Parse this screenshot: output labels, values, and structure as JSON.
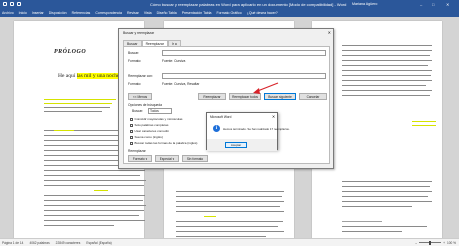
{
  "titlebar": {
    "document_title": "Cómo buscar y reemplazar palabras en Word para aplicarlo en un documento [Modo de compatibilidad] - Word",
    "user": "Mariana Agüero",
    "min": "–",
    "max": "□",
    "close": "✕"
  },
  "ribbon": {
    "tabs": [
      "Archivo",
      "Inicio",
      "Insertar",
      "Disposición",
      "Referencias",
      "Correspondencia",
      "Revisar",
      "Vista",
      "Diseño Tabla",
      "Presentación Tabla",
      "Formato Gráfico"
    ],
    "active_tab": "Inicio",
    "tell_me": "¿Qué desea hacer?"
  },
  "document": {
    "heading": "PRÓLOGO",
    "subhead_prefix": "He aquí ",
    "subhead_highlight": "las mil y una noches",
    "subhead_suffix": "..."
  },
  "find_replace": {
    "title": "Buscar y reemplazar",
    "close": "✕",
    "tabs": [
      "Buscar",
      "Reemplazar",
      "Ir a"
    ],
    "active_tab": "Reemplazar",
    "find_label": "Buscar:",
    "find_format_label": "Formato:",
    "find_format_value": "Fuente: Cursiva",
    "replace_label": "Reemplazar con:",
    "replace_format_label": "Formato:",
    "replace_format_value": "Fuente: Cursiva, Resaltar",
    "buttons": {
      "less": "<< Menos",
      "replace": "Reemplazar",
      "replace_all": "Reemplazar todos",
      "find_next": "Buscar siguiente",
      "cancel": "Cancelar"
    },
    "options_title": "Opciones de búsqueda",
    "search_label": "Buscar:",
    "search_value": "Todos",
    "options": [
      "Coincidir mayúsculas y minúsculas",
      "Solo palabras completas",
      "Usar caracteres comodín",
      "Suena como (inglés)",
      "Buscar todas las formas de la palabra (inglés)"
    ],
    "replace_section": "Reemplazar",
    "format_button": "Formato ▾",
    "special_button": "Especial ▾",
    "no_format_button": "Sin formato"
  },
  "message_box": {
    "title": "Microsoft Word",
    "close": "✕",
    "icon": "info-icon",
    "text": "Hemos terminado. Se han realizado 17 reemplazos.",
    "ok": "Aceptar"
  },
  "statusbar": {
    "page": "Página 1 de 14",
    "words": "4062 palabras",
    "chars": "22849 caracteres",
    "language": "Español (España)",
    "zoom": "100 %"
  }
}
